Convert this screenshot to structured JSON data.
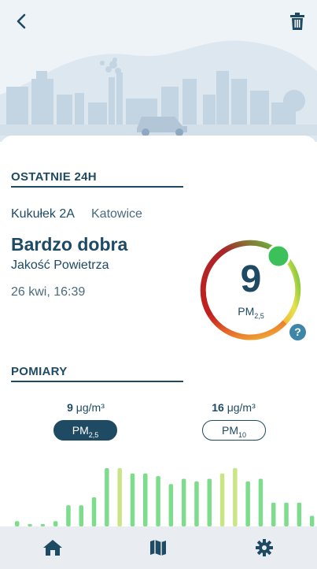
{
  "header": {
    "back_icon": "chevron-left-icon",
    "delete_icon": "trash-icon"
  },
  "sections": {
    "last24": "OSTATNIE 24H",
    "measurements": "POMIARY"
  },
  "station": {
    "name": "Kukułek 2A",
    "city": "Katowice"
  },
  "air_quality": {
    "label": "Bardzo dobra",
    "sublabel": "Jakość Powietrza",
    "datetime": "26 kwi, 16:39"
  },
  "gauge": {
    "value": "9",
    "unit_main": "PM",
    "unit_sub": "2,5",
    "help": "?",
    "level_fraction": 0.08
  },
  "measurements": [
    {
      "value": "9",
      "unit": "μg/m³",
      "pill_main": "PM",
      "pill_sub": "2,5",
      "active": true
    },
    {
      "value": "16",
      "unit": "μg/m³",
      "pill_main": "PM",
      "pill_sub": "10",
      "active": false
    }
  ],
  "chart_data": {
    "type": "bar",
    "values": [
      2,
      0.5,
      0.5,
      2,
      8,
      8,
      11,
      22,
      22,
      20,
      20,
      19,
      16,
      18,
      17,
      18,
      20,
      22,
      17,
      18,
      9,
      9,
      9,
      4
    ],
    "highlight_indices": [
      8,
      16,
      17
    ],
    "colors": {
      "normal": "#7edc8d",
      "highlight": "#c9e585"
    }
  },
  "nav": [
    {
      "name": "home",
      "icon": "home-icon"
    },
    {
      "name": "map",
      "icon": "map-icon"
    },
    {
      "name": "settings",
      "icon": "gear-icon"
    }
  ],
  "colors": {
    "primary": "#1e4a63",
    "accent_green": "#3cc15a",
    "help_blue": "#3d86a8"
  }
}
